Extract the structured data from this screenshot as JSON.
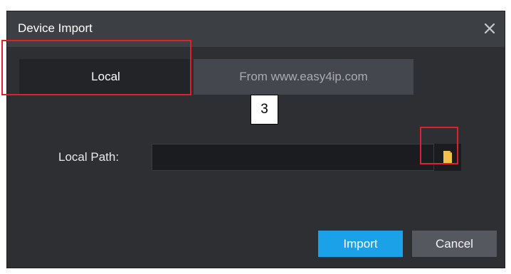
{
  "dialog": {
    "title": "Device Import",
    "close_icon": "close-icon"
  },
  "tabs": [
    {
      "label": "Local",
      "active": true
    },
    {
      "label": "From www.easy4ip.com",
      "active": false
    }
  ],
  "annotation": {
    "step_number": "3",
    "highlight_color": "#e0202a"
  },
  "form": {
    "local_path_label": "Local Path:",
    "local_path_value": "",
    "browse_icon": "folder-icon"
  },
  "buttons": {
    "import_label": "Import",
    "cancel_label": "Cancel"
  },
  "colors": {
    "accent": "#1aa1e8",
    "dialog_bg": "#2d2f33",
    "titlebar_bg": "#3c3f44"
  }
}
